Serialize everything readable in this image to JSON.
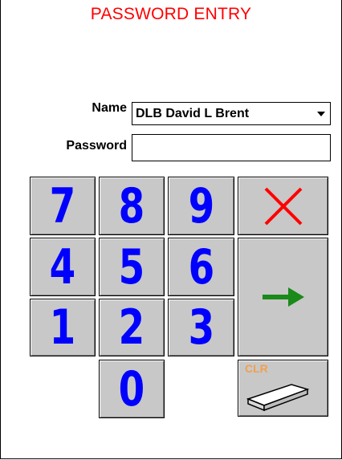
{
  "title": "PASSWORD ENTRY",
  "form": {
    "name_label": "Name",
    "name_value": "DLB David L Brent",
    "password_label": "Password",
    "password_value": ""
  },
  "keypad": {
    "k7": "7",
    "k8": "8",
    "k9": "9",
    "k4": "4",
    "k5": "5",
    "k6": "6",
    "k1": "1",
    "k2": "2",
    "k3": "3",
    "k0": "0",
    "clear_label": "CLR"
  },
  "colors": {
    "title": "#ff0000",
    "digits": "#0000ff",
    "key_face": "#c8c8c8",
    "cancel_x": "#ff0000",
    "enter_arrow": "#1a8a1a",
    "clear_text": "#f0a050"
  },
  "icons": {
    "cancel": "x-icon",
    "enter": "arrow-right-icon",
    "clear": "eraser-icon",
    "dropdown": "chevron-down-icon"
  }
}
